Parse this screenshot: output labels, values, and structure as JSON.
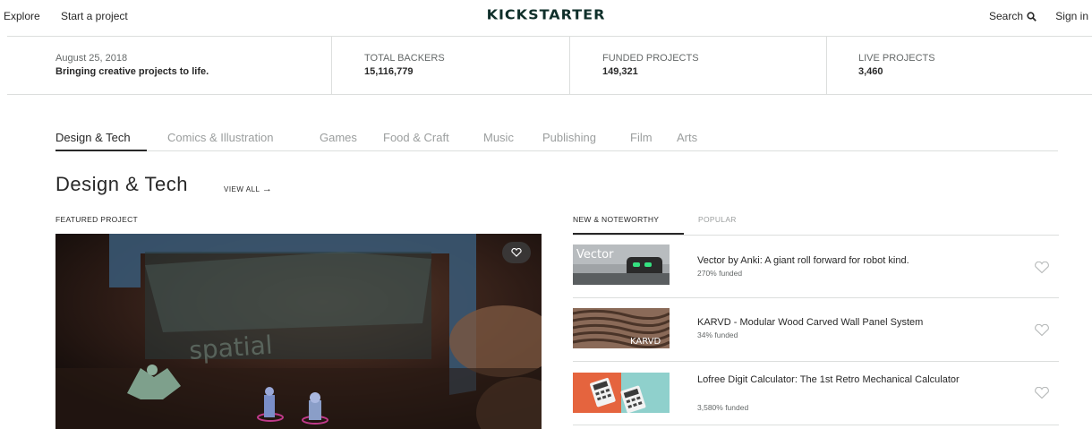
{
  "nav": {
    "explore": "Explore",
    "start_project": "Start a project",
    "logo": "KICKSTARTER",
    "search": "Search",
    "sign_in": "Sign in"
  },
  "stats": {
    "date": "August 25, 2018",
    "tagline": "Bringing creative projects to life.",
    "items": [
      {
        "label": "TOTAL BACKERS",
        "value": "15,116,779"
      },
      {
        "label": "FUNDED PROJECTS",
        "value": "149,321"
      },
      {
        "label": "LIVE PROJECTS",
        "value": "3,460"
      }
    ]
  },
  "categories": [
    "Design & Tech",
    "Comics & Illustration",
    "Games",
    "Food & Craft",
    "Music",
    "Publishing",
    "Film",
    "Arts"
  ],
  "section": {
    "title": "Design & Tech",
    "view_all": "VIEW ALL",
    "featured_label": "FEATURED PROJECT"
  },
  "list_tabs": {
    "new": "NEW & NOTEWORTHY",
    "popular": "POPULAR"
  },
  "projects": [
    {
      "title": "Vector by Anki: A giant roll forward for robot kind.",
      "funded": "270% funded",
      "thumb_text": "Vector"
    },
    {
      "title": "KARVD - Modular Wood Carved Wall Panel System",
      "funded": "34% funded",
      "thumb_text": "KARVD"
    },
    {
      "title": "Lofree Digit Calculator: The 1st Retro Mechanical Calculator",
      "funded": "3,580% funded"
    }
  ],
  "featured_image_text": "spatial",
  "colors": {
    "brand_green": "#05ce78",
    "text_dark": "#282828",
    "text_muted": "#9b9e9e",
    "divider": "#dcdedd"
  }
}
